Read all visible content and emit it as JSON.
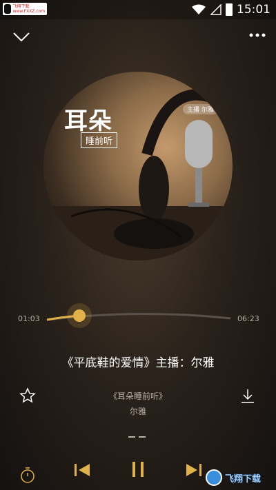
{
  "status_bar": {
    "app_badge_text": "飞翔下载 www.FXXZ.com",
    "time": "15:01"
  },
  "cover": {
    "title": "耳朵",
    "subtitle": "睡前听",
    "tag": "主播 尔雅"
  },
  "player": {
    "current_time": "01:03",
    "total_time": "06:23",
    "progress": 0.17,
    "track_title": "《平底鞋的爱情》主播：尔雅",
    "album_name": "《耳朵睡前听》",
    "host_name": "尔雅"
  },
  "watermark": {
    "text": "飞翔下载"
  },
  "colors": {
    "accent_gold": "#e2b24a",
    "muted_text": "#b8b0a5"
  }
}
